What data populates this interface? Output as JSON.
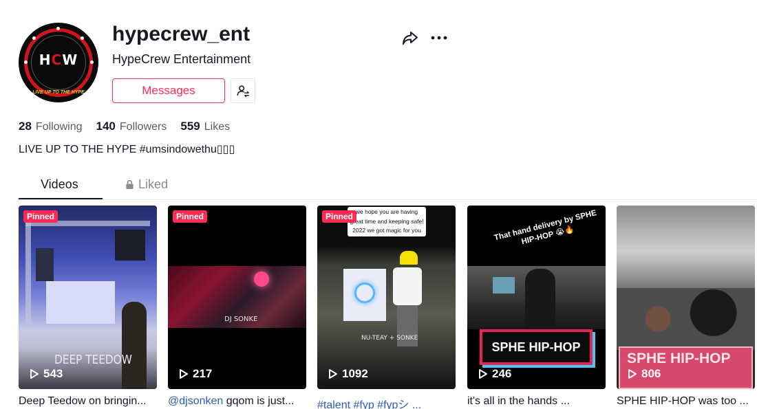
{
  "profile": {
    "username": "hypecrew_ent",
    "display_name": "HypeCrew Entertainment",
    "avatar": {
      "monogram_left": "H",
      "monogram_mid": "C",
      "monogram_right": "W",
      "tagline": "LIVE UP TO THE HYPE"
    },
    "messages_label": "Messages",
    "bio": "LIVE UP TO THE HYPE #umsindowethu▯▯▯"
  },
  "stats": {
    "following_count": "28",
    "following_label": "Following",
    "followers_count": "140",
    "followers_label": "Followers",
    "likes_count": "559",
    "likes_label": "Likes"
  },
  "tabs": {
    "videos": "Videos",
    "liked": "Liked"
  },
  "videos": [
    {
      "pinned_label": "Pinned",
      "views": "543",
      "overlay_text": "DEEP TEEDOW",
      "caption": "Deep Teedow on bringin..."
    },
    {
      "pinned_label": "Pinned",
      "views": "217",
      "overlay_text": "DJ SONKE",
      "caption_tag": "@djsonken",
      "caption_rest": " gqom is just..."
    },
    {
      "pinned_label": "Pinned",
      "views": "1092",
      "overlay_text": "NU-TEAY + SONKE",
      "bubble_text": "we hope you are having great time and keeping safe! 2022 we got magic for you",
      "caption_tag": "#talent #fyp #fypシ ..."
    },
    {
      "views": "246",
      "overlay_text": "That hand delivery by SPHE HIP-HOP 😭🔥",
      "sign_text": "SPHE HIP-HOP",
      "caption": "it's all in the hands ..."
    },
    {
      "views": "806",
      "sign_text": "SPHE HIP-HOP",
      "caption": "SPHE HIP-HOP was too ..."
    }
  ],
  "icons": {
    "share": "share-arrow-icon",
    "more": "ellipsis-icon",
    "follow_user": "user-swap-icon",
    "lock": "lock-icon",
    "play": "play-icon"
  },
  "colors": {
    "accent": "#fe2c55",
    "link": "#2b5db9",
    "text": "#161823",
    "muted": "#5a5b63"
  }
}
